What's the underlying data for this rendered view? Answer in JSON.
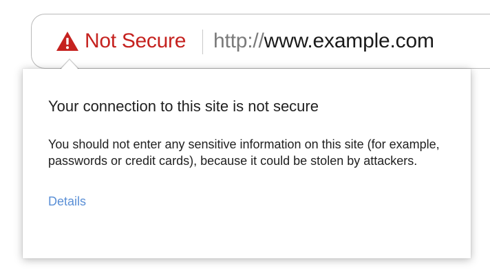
{
  "omnibox": {
    "security_icon": "warning-triangle-icon",
    "security_label": "Not Secure",
    "security_color": "#c5221f",
    "url_scheme": "http://",
    "url_host": "www.example.com"
  },
  "bubble": {
    "title": "Your connection to this site is not secure",
    "body": "You should not enter any sensitive information on this site (for example, passwords or credit cards), because it could be stolen by attackers.",
    "link_label": "Details",
    "link_color": "#5a8fd6"
  }
}
